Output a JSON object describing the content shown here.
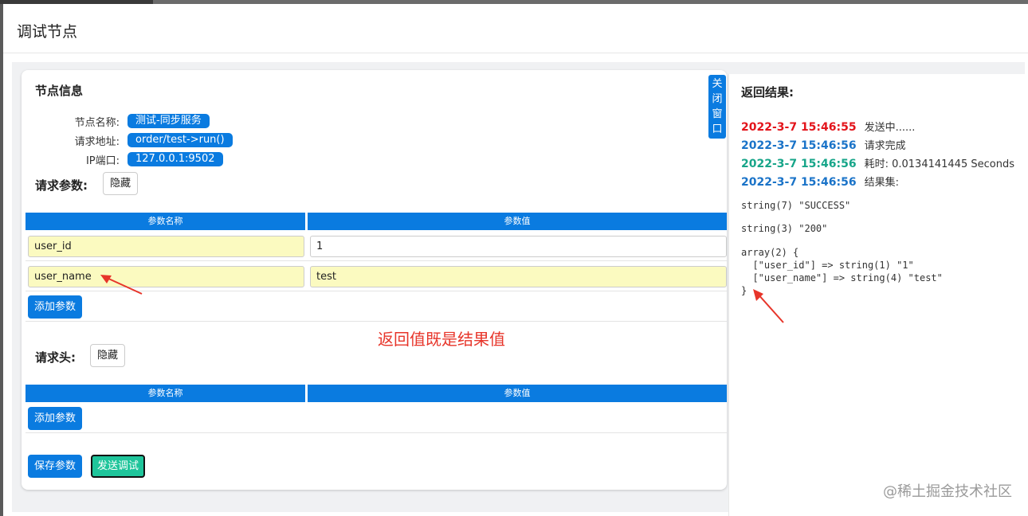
{
  "window": {
    "title": "调试节点"
  },
  "node_info": {
    "title": "节点信息",
    "fields": [
      {
        "label": "节点名称:",
        "value": "测试-同步服务"
      },
      {
        "label": "请求地址:",
        "value": "order/test->run()"
      },
      {
        "label": "IP端口:",
        "value": "127.0.0.1:9502"
      }
    ]
  },
  "request_params": {
    "title": "请求参数:",
    "hide_label": "隐藏",
    "headers": [
      "参数名称",
      "参数值"
    ],
    "rows": [
      {
        "name": "user_id",
        "value": "1"
      },
      {
        "name": "user_name",
        "value": "test"
      }
    ],
    "add_label": "添加参数"
  },
  "request_headers": {
    "title": "请求头:",
    "hide_label": "隐藏",
    "headers": [
      "参数名称",
      "参数值"
    ],
    "add_label": "添加参数"
  },
  "actions": {
    "save_label": "保存参数",
    "send_label": "发送调试"
  },
  "close_window": [
    "关",
    "闭",
    "窗",
    "口"
  ],
  "annotation": "返回值既是结果值",
  "result": {
    "title": "返回结果:",
    "logs": [
      {
        "time": "2022-3-7 15:46:55",
        "message": "发送中......",
        "color": "#e3141b"
      },
      {
        "time": "2022-3-7 15:46:56",
        "message": "请求完成",
        "color": "#1a73c8"
      },
      {
        "time": "2022-3-7 15:46:56",
        "message": "耗时: 0.0134141445 Seconds",
        "color": "#17a589"
      },
      {
        "time": "2022-3-7 15:46:56",
        "message": "结果集:",
        "color": "#1a73c8"
      }
    ],
    "output": [
      "string(7) \"SUCCESS\"",
      "string(3) \"200\"",
      "array(2) {\n  [\"user_id\"] => string(1) \"1\"\n  [\"user_name\"] => string(4) \"test\"\n}"
    ]
  },
  "watermark": "@稀土掘金技术社区",
  "colors": {
    "primary": "#0a7be0",
    "success": "#1fc59b",
    "annotation": "#e7352a"
  }
}
